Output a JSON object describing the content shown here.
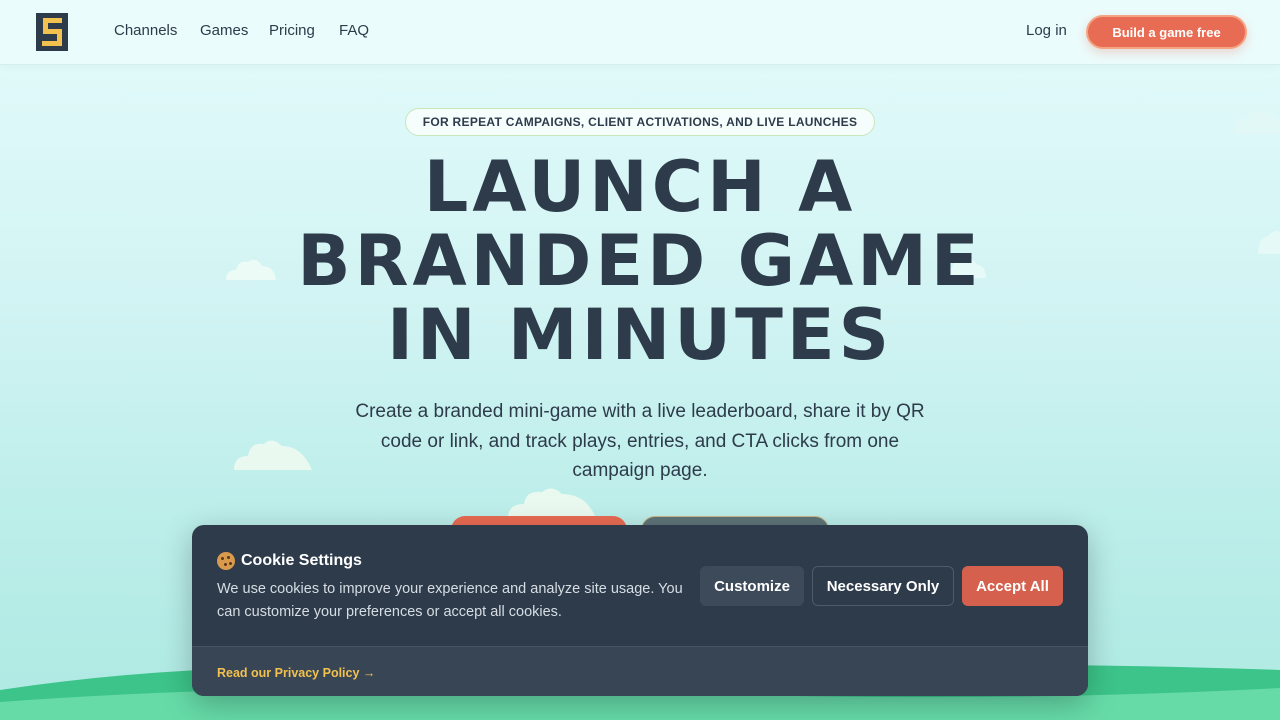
{
  "nav": {
    "links": [
      "Channels",
      "Games",
      "Pricing",
      "FAQ"
    ],
    "login_label": "Log in",
    "cta_label": "Build a game free"
  },
  "hero": {
    "tagline": "FOR REPEAT CAMPAIGNS, CLIENT ACTIVATIONS, AND LIVE LAUNCHES",
    "headline_lines": [
      "LAUNCH A",
      "BRANDED GAME",
      "IN MINUTES"
    ],
    "subtitle": "Create a branded mini-game with a live leaderboard, share it by QR code or link, and track plays, entries, and CTA clicks from one campaign page."
  },
  "cookie": {
    "title": "Cookie Settings",
    "text": "We use cookies to improve your experience and analyze site usage. You can customize your preferences or accept all cookies.",
    "buttons": {
      "customize": "Customize",
      "necessary": "Necessary Only",
      "accept": "Accept All"
    },
    "privacy_link": "Read our Privacy Policy →"
  },
  "colors": {
    "accent": "#e86b53",
    "dark": "#2e3b4a",
    "link": "#f2c14e"
  },
  "icons": {
    "logo": "pixel-s-logo-icon",
    "cookie": "cookie-icon"
  }
}
